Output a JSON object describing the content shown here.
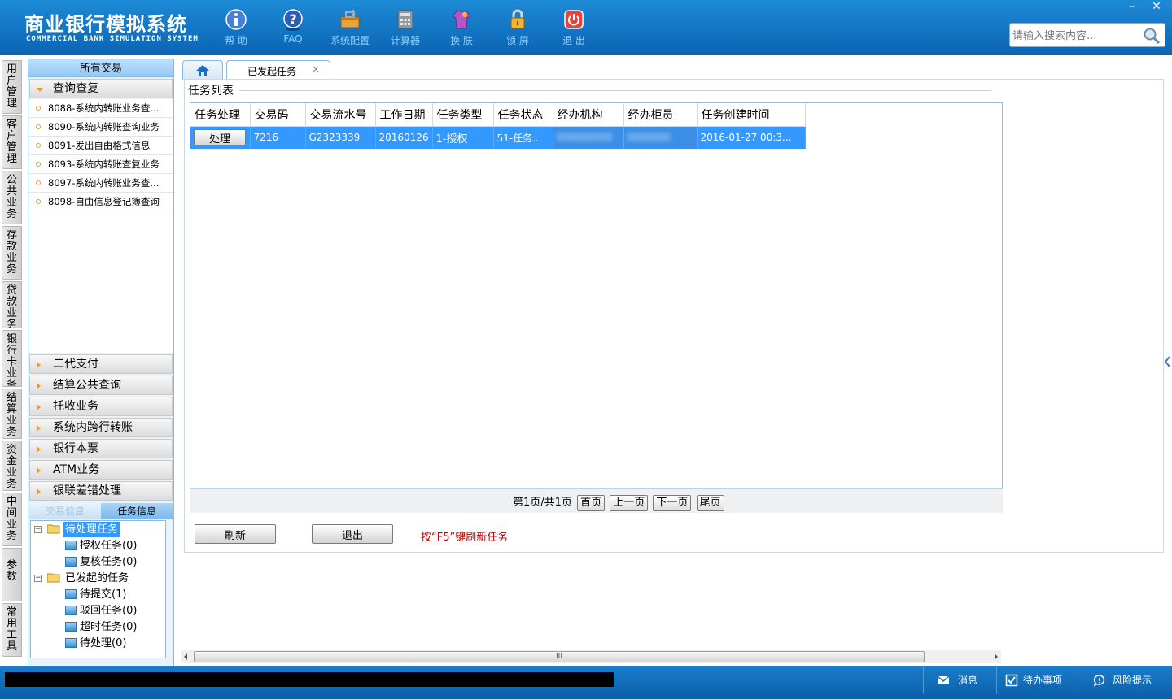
{
  "header": {
    "title": "商业银行模拟系统",
    "subtitle": "COMMERCIAL BANK SIMULATION SYSTEM",
    "toolbar": [
      {
        "label": "帮 助",
        "icon": "info-icon"
      },
      {
        "label": "FAQ",
        "icon": "question-icon"
      },
      {
        "label": "系统配置",
        "icon": "toolbox-icon"
      },
      {
        "label": "计算器",
        "icon": "calculator-icon"
      },
      {
        "label": "换 肤",
        "icon": "shirt-icon"
      },
      {
        "label": "锁 屏",
        "icon": "lock-icon"
      },
      {
        "label": "退 出",
        "icon": "power-icon"
      }
    ],
    "search_placeholder": "请输入搜索内容...",
    "win_min": "–",
    "win_close": "✕"
  },
  "rail": [
    "用户管理",
    "客户管理",
    "公共业务",
    "存款业务",
    "贷款业务",
    "银行卡业务",
    "结算业务",
    "资金业务",
    "中间业务",
    "参数",
    "常用工具"
  ],
  "left": {
    "header": "所有交易",
    "query_group": "查询查复",
    "query_items": [
      "8088-系统内转账业务查...",
      "8090-系统内转账查询业务",
      "8091-发出自由格式信息",
      "8093-系统内转账查复业务",
      "8097-系统内转账业务查...",
      "8098-自由信息登记簿查询"
    ],
    "groups": [
      "二代支付",
      "结算公共查询",
      "托收业务",
      "系统内跨行转账",
      "银行本票",
      "ATM业务",
      "银联差错处理"
    ],
    "subtabs": [
      "交易信息",
      "任务信息"
    ],
    "tree": {
      "pending": "待处理任务",
      "auth": "授权任务(0)",
      "review": "复核任务(0)",
      "initiated": "已发起的任务",
      "to_submit": "待提交(1)",
      "rejected": "驳回任务(0)",
      "timeout": "超时任务(0)",
      "waiting": "待处理(0)"
    }
  },
  "tabs": {
    "active": "已发起任务",
    "close": "×"
  },
  "main": {
    "list_title": "任务列表",
    "columns": [
      "任务处理",
      "交易码",
      "交易流水号",
      "工作日期",
      "任务类型",
      "任务状态",
      "经办机构",
      "经办柜员",
      "任务创建时间"
    ],
    "rows": [
      {
        "action": "处理",
        "code": "7216",
        "serial": "G2323339",
        "date": "20160126",
        "type": "1-授权",
        "status": "51-任务...",
        "org": "000000000",
        "teller": "0000000",
        "created": "2016-01-27 00:3..."
      }
    ],
    "pager": {
      "info": "第1页/共1页",
      "first": "首页",
      "prev": "上一页",
      "next": "下一页",
      "last": "尾页"
    },
    "refresh": "刷新",
    "exit": "退出",
    "hint": "按“F5”键刷新任务"
  },
  "status": {
    "message": "消息",
    "todo": "待办事项",
    "risk": "风险提示"
  }
}
